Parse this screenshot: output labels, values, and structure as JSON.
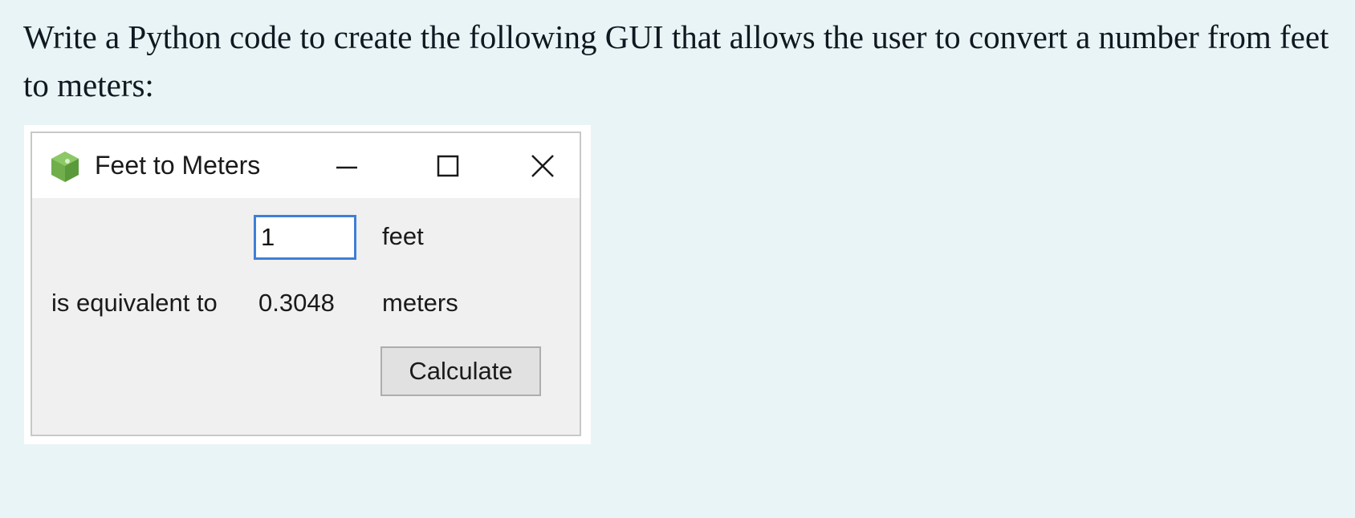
{
  "prompt_text": "Write a Python code to create the following GUI that allows the user to convert a number from feet to meters:",
  "window": {
    "title": "Feet to Meters",
    "icon": "green-gem-app-icon",
    "controls": {
      "minimize_icon": "minimize-icon",
      "maximize_icon": "maximize-icon",
      "close_icon": "close-icon"
    }
  },
  "form": {
    "feet_value": "1",
    "feet_label": "feet",
    "equivalent_label": "is equivalent to",
    "result_value": "0.3048",
    "meters_label": "meters",
    "calculate_label": "Calculate"
  },
  "colors": {
    "page_background": "#e9f4f6",
    "window_client": "#f0f0f0",
    "input_focus_border": "#3f7fd8",
    "icon_green": "#6fae4a"
  }
}
